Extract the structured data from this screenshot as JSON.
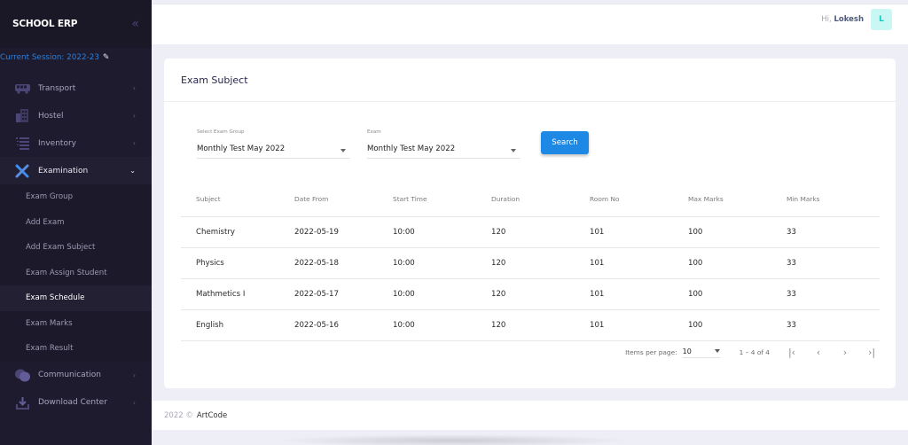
{
  "app": {
    "brand": "SCHOOL ERP",
    "session_label": "Current Session: 2022-23"
  },
  "sidebar": {
    "items": [
      {
        "label": "Transport",
        "icon": "bus-icon",
        "expanded": false
      },
      {
        "label": "Hostel",
        "icon": "building-icon",
        "expanded": false
      },
      {
        "label": "Inventory",
        "icon": "list-icon",
        "expanded": false
      },
      {
        "label": "Examination",
        "icon": "pencil-ruler-icon",
        "expanded": true
      },
      {
        "label": "Communication",
        "icon": "chat-icon",
        "expanded": false
      },
      {
        "label": "Download Center",
        "icon": "download-icon",
        "expanded": false
      }
    ],
    "examination_submenu": [
      {
        "label": "Exam Group",
        "active": false
      },
      {
        "label": "Add Exam",
        "active": false
      },
      {
        "label": "Add Exam Subject",
        "active": false
      },
      {
        "label": "Exam Assign Student",
        "active": false
      },
      {
        "label": "Exam Schedule",
        "active": true
      },
      {
        "label": "Exam Marks",
        "active": false
      },
      {
        "label": "Exam Result",
        "active": false
      }
    ]
  },
  "header": {
    "greeting": "Hi,",
    "user_name": "Lokesh",
    "avatar_initial": "L"
  },
  "card": {
    "title": "Exam Subject",
    "filters": {
      "exam_group": {
        "label": "Select Exam Group",
        "value": "Monthly Test May 2022"
      },
      "exam": {
        "label": "Exam",
        "value": "Monthly Test May 2022"
      },
      "search_label": "Search"
    },
    "table": {
      "columns": [
        "Subject",
        "Date From",
        "Start Time",
        "Duration",
        "Room No",
        "Max Marks",
        "Min Marks"
      ],
      "rows": [
        [
          "Chemistry",
          "2022-05-19",
          "10:00",
          "120",
          "101",
          "100",
          "33"
        ],
        [
          "Physics",
          "2022-05-18",
          "10:00",
          "120",
          "101",
          "100",
          "33"
        ],
        [
          "Mathmetics I",
          "2022-05-17",
          "10:00",
          "120",
          "101",
          "100",
          "33"
        ],
        [
          "English",
          "2022-05-16",
          "10:00",
          "120",
          "101",
          "100",
          "33"
        ]
      ]
    },
    "paginator": {
      "items_per_page_label": "Items per page:",
      "items_per_page": "10",
      "range": "1 – 4 of 4"
    }
  },
  "footer": {
    "year": "2022 ©",
    "brand": "ArtCode"
  },
  "colors": {
    "sidebar_bg": "#1e1b2e",
    "session_text": "#2e7fd8",
    "primary_button": "#1e88e5",
    "avatar_bg": "#c8f7f4",
    "avatar_text": "#1bc5bd",
    "icon_purple": "#4b4676",
    "icon_blue": "#3d8ef0"
  }
}
